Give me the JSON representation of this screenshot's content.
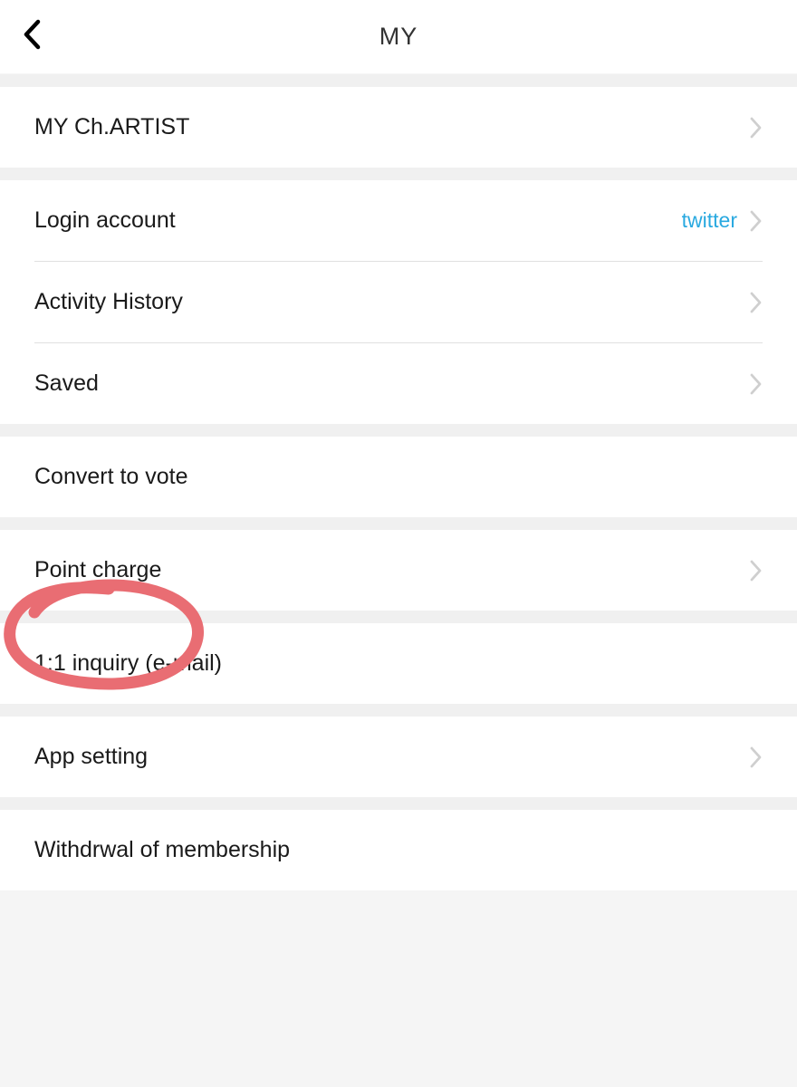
{
  "header": {
    "title": "MY"
  },
  "rows": {
    "my_ch_artist": {
      "label": "MY Ch.ARTIST"
    },
    "login_account": {
      "label": "Login account",
      "value": "twitter"
    },
    "activity_history": {
      "label": "Activity History"
    },
    "saved": {
      "label": "Saved"
    },
    "convert_to_vote": {
      "label": "Convert to vote"
    },
    "point_charge": {
      "label": "Point charge"
    },
    "inquiry": {
      "label": "1:1 inquiry (e-mail)"
    },
    "app_setting": {
      "label": "App setting"
    },
    "withdrawal": {
      "label": "Withdrwal of membership"
    }
  },
  "colors": {
    "accent": "#29a9e0",
    "annotation": "#e96d73"
  }
}
